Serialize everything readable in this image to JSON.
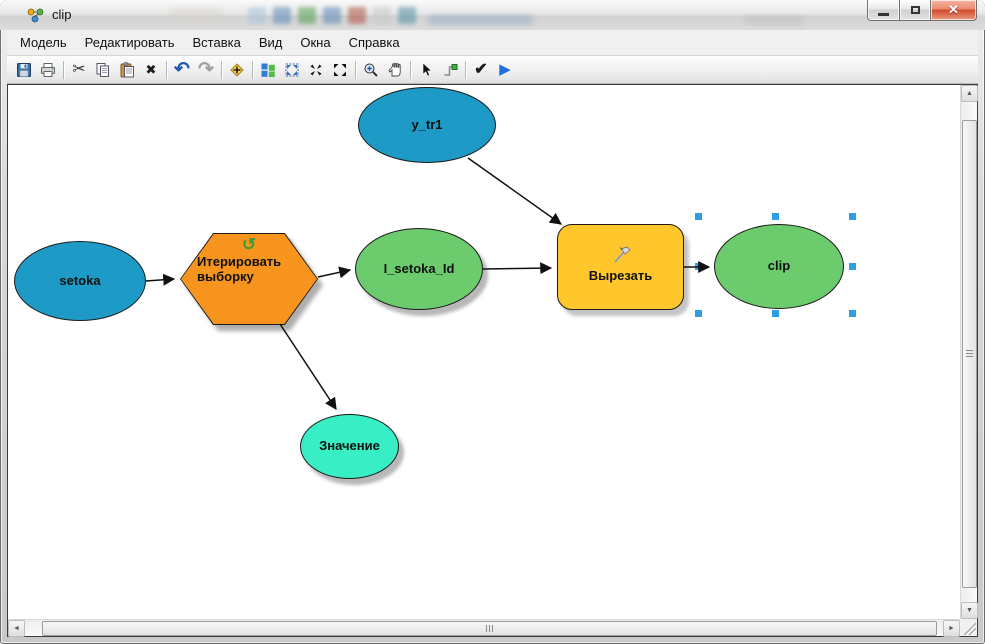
{
  "window": {
    "title": "clip",
    "controls": {
      "minimize": "minimize",
      "maximize": "restore",
      "close": "close",
      "close_glyph": "✕"
    }
  },
  "menu": {
    "items": [
      "Модель",
      "Редактировать",
      "Вставка",
      "Вид",
      "Окна",
      "Справка"
    ]
  },
  "toolbar": {
    "icons": [
      "save-icon",
      "print-icon",
      "cut-icon",
      "copy-icon",
      "paste-icon",
      "delete-icon",
      "undo-icon",
      "redo-icon",
      "add-data-icon",
      "auto-layout-icon",
      "full-extent-icon",
      "fixed-zoom-in-icon",
      "fixed-zoom-out-icon",
      "zoom-in-icon",
      "pan-icon",
      "select-icon",
      "connect-icon",
      "validate-icon",
      "run-icon"
    ],
    "glyphs": {
      "cut": "✂",
      "delete": "✖",
      "undo": "↶",
      "redo": "↷",
      "validate": "✔",
      "run": "▶",
      "iterator": "↺"
    }
  },
  "scrollbars": {
    "up": "▲",
    "down": "▼",
    "left": "◄",
    "right": "►"
  },
  "diagram": {
    "nodes": [
      {
        "id": "y_tr1",
        "label": "y_tr1",
        "shape": "ellipse",
        "role": "input-variable",
        "fill": "#1E9AC6"
      },
      {
        "id": "setoka",
        "label": "setoka",
        "shape": "ellipse",
        "role": "input-variable",
        "fill": "#1E9AC6"
      },
      {
        "id": "iterate",
        "label": "Итерировать выборку",
        "shape": "hexagon",
        "role": "iterator",
        "fill": "#F7941E"
      },
      {
        "id": "i_setoka_id",
        "label": "I_setoka_Id",
        "shape": "ellipse",
        "role": "derived-variable",
        "fill": "#6CCB6C"
      },
      {
        "id": "cut_tool",
        "label": "Вырезать",
        "shape": "rounded-rect",
        "role": "tool",
        "fill": "#FFC72B"
      },
      {
        "id": "clip_out",
        "label": "clip",
        "shape": "ellipse",
        "role": "output-variable",
        "fill": "#6CCB6C",
        "selected": true
      },
      {
        "id": "value",
        "label": "Значение",
        "shape": "ellipse",
        "role": "value-variable",
        "fill": "#38EEC4"
      }
    ],
    "edges": [
      {
        "from": "setoka",
        "to": "iterate"
      },
      {
        "from": "iterate",
        "to": "i_setoka_id"
      },
      {
        "from": "iterate",
        "to": "value"
      },
      {
        "from": "y_tr1",
        "to": "cut_tool"
      },
      {
        "from": "i_setoka_id",
        "to": "cut_tool"
      },
      {
        "from": "cut_tool",
        "to": "clip_out"
      }
    ],
    "selection_color": "#2E9FE5"
  }
}
